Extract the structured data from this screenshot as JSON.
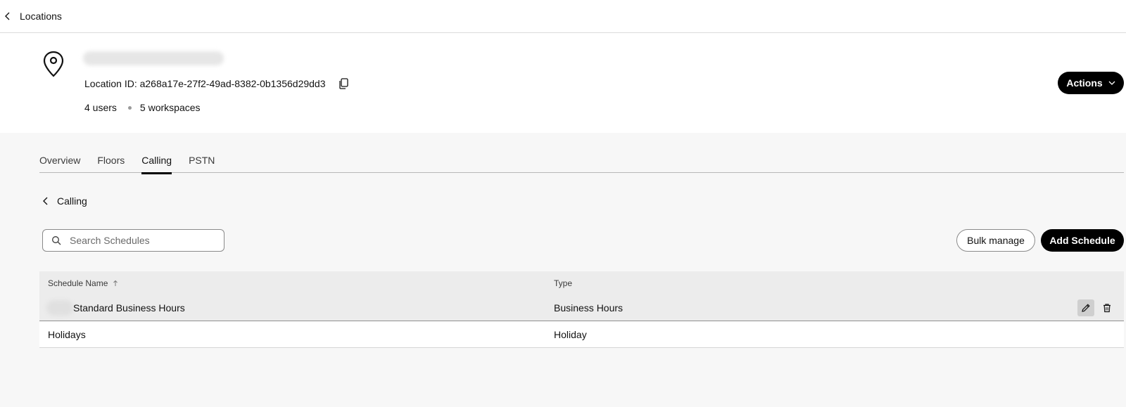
{
  "topbar": {
    "back_label": "Locations"
  },
  "header": {
    "location_id_label": "Location ID: a268a17e-27f2-49ad-8382-0b1356d29dd3",
    "users": "4 users",
    "workspaces": "5 workspaces",
    "actions_label": "Actions"
  },
  "tabs": [
    {
      "label": "Overview",
      "active": false
    },
    {
      "label": "Floors",
      "active": false
    },
    {
      "label": "Calling",
      "active": true
    },
    {
      "label": "PSTN",
      "active": false
    }
  ],
  "section": {
    "back_label": "Calling"
  },
  "search": {
    "placeholder": "Search Schedules",
    "value": ""
  },
  "toolbar": {
    "bulk_label": "Bulk manage",
    "add_label": "Add Schedule"
  },
  "table": {
    "columns": [
      "Schedule Name",
      "Type"
    ],
    "sort_icon": "arrow-up-icon",
    "rows": [
      {
        "name": "Standard Business Hours",
        "type": "Business Hours"
      },
      {
        "name": "Holidays",
        "type": "Holiday"
      }
    ]
  },
  "colors": {
    "primary": "#000000",
    "page_bg": "#f7f7f7",
    "header_bg": "#ffffff",
    "table_header_bg": "#ececec"
  }
}
